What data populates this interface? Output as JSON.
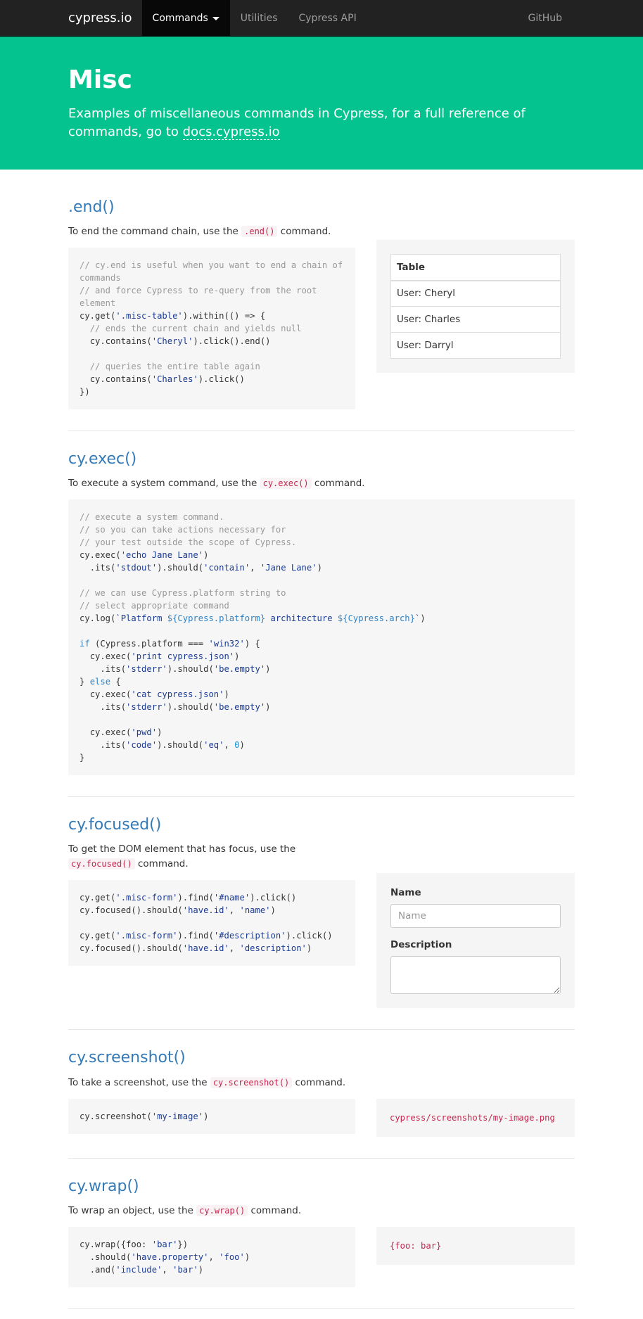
{
  "nav": {
    "brand": "cypress.io",
    "items": [
      {
        "label": "Commands",
        "active": true
      },
      {
        "label": "Utilities"
      },
      {
        "label": "Cypress API"
      }
    ],
    "github": "GitHub"
  },
  "banner": {
    "title": "Misc",
    "description": "Examples of miscellaneous commands in Cypress, for a full reference of commands, go to",
    "link_text": "docs.cypress.io"
  },
  "sections": {
    "end": {
      "title": ".end()",
      "desc_pre": "To end the command chain, use the",
      "desc_code": ".end()",
      "desc_post": "command.",
      "table": {
        "header": "Table",
        "rows": [
          "User: Cheryl",
          "User: Charles",
          "User: Darryl"
        ]
      }
    },
    "exec": {
      "title": "cy.exec()",
      "desc_pre": "To execute a system command, use the",
      "desc_code": "cy.exec()",
      "desc_post": "command."
    },
    "focused": {
      "title": "cy.focused()",
      "desc_pre": "To get the DOM element that has focus, use the",
      "desc_code": "cy.focused()",
      "desc_post": "command.",
      "form": {
        "name_label": "Name",
        "name_placeholder": "Name",
        "description_label": "Description"
      }
    },
    "screenshot": {
      "title": "cy.screenshot()",
      "desc_pre": "To take a screenshot, use the",
      "desc_code": "cy.screenshot()",
      "desc_post": "command.",
      "output": "cypress/screenshots/my-image.png"
    },
    "wrap": {
      "title": "cy.wrap()",
      "desc_pre": "To wrap an object, use the",
      "desc_code": "cy.wrap()",
      "desc_post": "command.",
      "output": "{foo: bar}"
    }
  },
  "code": {
    "end": [
      [
        "c",
        "// cy.end is useful when you want to end a chain of commands"
      ],
      [
        "c",
        "// and force Cypress to re-query from the root element"
      ],
      [
        "m",
        "cy.get(",
        [
          "s",
          "'.misc-table'"
        ],
        ").within(() => {"
      ],
      [
        "c",
        "  // ends the current chain and yields null"
      ],
      [
        "m",
        "  cy.contains(",
        [
          "s",
          "'Cheryl'"
        ],
        ").click().end()"
      ],
      [
        "m",
        ""
      ],
      [
        "c",
        "  // queries the entire table again"
      ],
      [
        "m",
        "  cy.contains(",
        [
          "s",
          "'Charles'"
        ],
        ").click()"
      ],
      [
        "m",
        "})"
      ]
    ],
    "exec": [
      [
        "c",
        "// execute a system command."
      ],
      [
        "c",
        "// so you can take actions necessary for"
      ],
      [
        "c",
        "// your test outside the scope of Cypress."
      ],
      [
        "m",
        "cy.exec(",
        [
          "s",
          "'echo Jane Lane'"
        ],
        ")"
      ],
      [
        "m",
        "  .its(",
        [
          "s",
          "'stdout'"
        ],
        ").should(",
        [
          "s",
          "'contain'"
        ],
        ", ",
        [
          "s",
          "'Jane Lane'"
        ],
        ")"
      ],
      [
        "m",
        ""
      ],
      [
        "c",
        "// we can use Cypress.platform string to"
      ],
      [
        "c",
        "// select appropriate command"
      ],
      [
        "m",
        "cy.log(",
        [
          "s",
          "`Platform "
        ],
        [
          "k",
          "${Cypress.platform}"
        ],
        [
          "s",
          " architecture "
        ],
        [
          "k",
          "${Cypress.arch}"
        ],
        [
          "s",
          "`"
        ],
        ")"
      ],
      [
        "m",
        ""
      ],
      [
        "m",
        [
          "k",
          "if"
        ],
        " (Cypress.platform === ",
        [
          "s",
          "'win32'"
        ],
        ") {"
      ],
      [
        "m",
        "  cy.exec(",
        [
          "s",
          "'print cypress.json'"
        ],
        ")"
      ],
      [
        "m",
        "    .its(",
        [
          "s",
          "'stderr'"
        ],
        ").should(",
        [
          "s",
          "'be.empty'"
        ],
        ")"
      ],
      [
        "m",
        "} ",
        [
          "k",
          "else"
        ],
        " {"
      ],
      [
        "m",
        "  cy.exec(",
        [
          "s",
          "'cat cypress.json'"
        ],
        ")"
      ],
      [
        "m",
        "    .its(",
        [
          "s",
          "'stderr'"
        ],
        ").should(",
        [
          "s",
          "'be.empty'"
        ],
        ")"
      ],
      [
        "m",
        ""
      ],
      [
        "m",
        "  cy.exec(",
        [
          "s",
          "'pwd'"
        ],
        ")"
      ],
      [
        "m",
        "    .its(",
        [
          "s",
          "'code'"
        ],
        ").should(",
        [
          "s",
          "'eq'"
        ],
        ", ",
        [
          "n",
          "0"
        ],
        ")"
      ],
      [
        "m",
        "}"
      ]
    ],
    "focused": [
      [
        "m",
        "cy.get(",
        [
          "s",
          "'.misc-form'"
        ],
        ").find(",
        [
          "s",
          "'#name'"
        ],
        ").click()"
      ],
      [
        "m",
        "cy.focused().should(",
        [
          "s",
          "'have.id'"
        ],
        ", ",
        [
          "s",
          "'name'"
        ],
        ")"
      ],
      [
        "m",
        ""
      ],
      [
        "m",
        "cy.get(",
        [
          "s",
          "'.misc-form'"
        ],
        ").find(",
        [
          "s",
          "'#description'"
        ],
        ").click()"
      ],
      [
        "m",
        "cy.focused().should(",
        [
          "s",
          "'have.id'"
        ],
        ", ",
        [
          "s",
          "'description'"
        ],
        ")"
      ]
    ],
    "screenshot": [
      [
        "m",
        "cy.screenshot(",
        [
          "s",
          "'my-image'"
        ],
        ")"
      ]
    ],
    "wrap": [
      [
        "m",
        "cy.wrap({foo: ",
        [
          "s",
          "'bar'"
        ],
        "})"
      ],
      [
        "m",
        "  .should(",
        [
          "s",
          "'have.property'"
        ],
        ", ",
        [
          "s",
          "'foo'"
        ],
        ")"
      ],
      [
        "m",
        "  .and(",
        [
          "s",
          "'include'"
        ],
        ", ",
        [
          "s",
          "'bar'"
        ],
        ")"
      ]
    ]
  }
}
